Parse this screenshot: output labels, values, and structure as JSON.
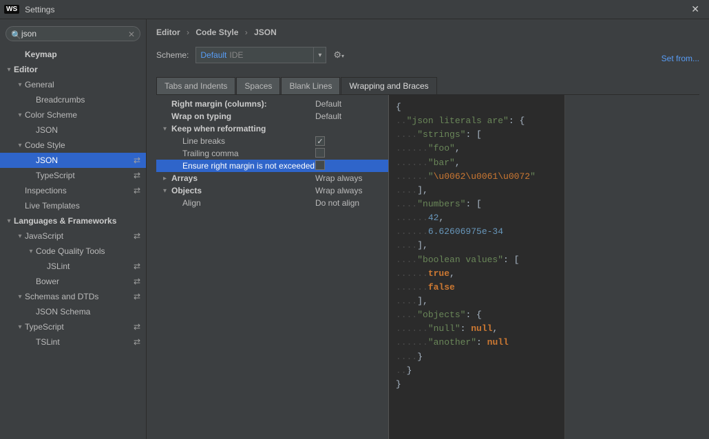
{
  "window": {
    "title": "Settings",
    "badge": "WS"
  },
  "search": {
    "value": "json"
  },
  "tree": [
    {
      "label": "Keymap",
      "indent": 1,
      "arrow": "",
      "bold": true
    },
    {
      "label": "Editor",
      "indent": 0,
      "arrow": "▾",
      "bold": true
    },
    {
      "label": "General",
      "indent": 1,
      "arrow": "▾",
      "bold": false
    },
    {
      "label": "Breadcrumbs",
      "indent": 2,
      "arrow": "",
      "bold": false
    },
    {
      "label": "Color Scheme",
      "indent": 1,
      "arrow": "▾",
      "bold": false
    },
    {
      "label": "JSON",
      "indent": 2,
      "arrow": "",
      "bold": false
    },
    {
      "label": "Code Style",
      "indent": 1,
      "arrow": "▾",
      "bold": false
    },
    {
      "label": "JSON",
      "indent": 2,
      "arrow": "",
      "bold": false,
      "selected": true,
      "icon": "⇄"
    },
    {
      "label": "TypeScript",
      "indent": 2,
      "arrow": "",
      "bold": false,
      "icon": "⇄"
    },
    {
      "label": "Inspections",
      "indent": 1,
      "arrow": "",
      "bold": false,
      "icon": "⇄"
    },
    {
      "label": "Live Templates",
      "indent": 1,
      "arrow": "",
      "bold": false
    },
    {
      "label": "Languages & Frameworks",
      "indent": 0,
      "arrow": "▾",
      "bold": true
    },
    {
      "label": "JavaScript",
      "indent": 1,
      "arrow": "▾",
      "bold": false,
      "icon": "⇄"
    },
    {
      "label": "Code Quality Tools",
      "indent": 2,
      "arrow": "▾",
      "bold": false
    },
    {
      "label": "JSLint",
      "indent": 3,
      "arrow": "",
      "bold": false,
      "icon": "⇄"
    },
    {
      "label": "Bower",
      "indent": 2,
      "arrow": "",
      "bold": false,
      "icon": "⇄"
    },
    {
      "label": "Schemas and DTDs",
      "indent": 1,
      "arrow": "▾",
      "bold": false,
      "icon": "⇄"
    },
    {
      "label": "JSON Schema",
      "indent": 2,
      "arrow": "",
      "bold": false
    },
    {
      "label": "TypeScript",
      "indent": 1,
      "arrow": "▾",
      "bold": false,
      "icon": "⇄"
    },
    {
      "label": "TSLint",
      "indent": 2,
      "arrow": "",
      "bold": false,
      "icon": "⇄"
    }
  ],
  "breadcrumb": [
    "Editor",
    "Code Style",
    "JSON"
  ],
  "scheme": {
    "label": "Scheme:",
    "name": "Default",
    "suffix": "IDE",
    "setfrom": "Set from..."
  },
  "tabs": [
    "Tabs and Indents",
    "Spaces",
    "Blank Lines",
    "Wrapping and Braces"
  ],
  "active_tab": 3,
  "options": [
    {
      "label": "Right margin (columns):",
      "value": "Default",
      "indent": 0,
      "bold": true,
      "arrow": ""
    },
    {
      "label": "Wrap on typing",
      "value": "Default",
      "indent": 0,
      "bold": true,
      "arrow": ""
    },
    {
      "label": "Keep when reformatting",
      "value": "",
      "indent": 0,
      "bold": true,
      "arrow": "▾"
    },
    {
      "label": "Line breaks",
      "value": "",
      "indent": 1,
      "bold": false,
      "arrow": "",
      "checkbox": true,
      "checked": true
    },
    {
      "label": "Trailing comma",
      "value": "",
      "indent": 1,
      "bold": false,
      "arrow": "",
      "checkbox": true,
      "checked": false
    },
    {
      "label": "Ensure right margin is not exceeded",
      "value": "",
      "indent": 1,
      "bold": false,
      "arrow": "",
      "checkbox": true,
      "checked": false,
      "selected": true
    },
    {
      "label": "Arrays",
      "value": "Wrap always",
      "indent": 0,
      "bold": true,
      "arrow": "▸"
    },
    {
      "label": "Objects",
      "value": "Wrap always",
      "indent": 0,
      "bold": true,
      "arrow": "▾"
    },
    {
      "label": "Align",
      "value": "Do not align",
      "indent": 1,
      "bold": false,
      "arrow": ""
    }
  ],
  "code": {
    "lines": [
      [
        {
          "t": "brace",
          "v": "{"
        }
      ],
      [
        {
          "t": "ws",
          "v": ".."
        },
        {
          "t": "str",
          "v": "\"json literals are\""
        },
        {
          "t": "brace",
          "v": ": {"
        }
      ],
      [
        {
          "t": "ws",
          "v": "...."
        },
        {
          "t": "str",
          "v": "\"strings\""
        },
        {
          "t": "brace",
          "v": ": ["
        }
      ],
      [
        {
          "t": "ws",
          "v": "......"
        },
        {
          "t": "str",
          "v": "\"foo\""
        },
        {
          "t": "brace",
          "v": ","
        }
      ],
      [
        {
          "t": "ws",
          "v": "......"
        },
        {
          "t": "str",
          "v": "\"bar\""
        },
        {
          "t": "brace",
          "v": ","
        }
      ],
      [
        {
          "t": "ws",
          "v": "......"
        },
        {
          "t": "str",
          "v": "\""
        },
        {
          "t": "esc",
          "v": "\\u0062\\u0061\\u0072"
        },
        {
          "t": "str",
          "v": "\""
        }
      ],
      [
        {
          "t": "ws",
          "v": "...."
        },
        {
          "t": "brace",
          "v": "],"
        }
      ],
      [
        {
          "t": "ws",
          "v": "...."
        },
        {
          "t": "str",
          "v": "\"numbers\""
        },
        {
          "t": "brace",
          "v": ": ["
        }
      ],
      [
        {
          "t": "ws",
          "v": "......"
        },
        {
          "t": "num",
          "v": "42"
        },
        {
          "t": "brace",
          "v": ","
        }
      ],
      [
        {
          "t": "ws",
          "v": "......"
        },
        {
          "t": "num",
          "v": "6.62606975e-34"
        }
      ],
      [
        {
          "t": "ws",
          "v": "...."
        },
        {
          "t": "brace",
          "v": "],"
        }
      ],
      [
        {
          "t": "ws",
          "v": "...."
        },
        {
          "t": "str",
          "v": "\"boolean values\""
        },
        {
          "t": "brace",
          "v": ": ["
        }
      ],
      [
        {
          "t": "ws",
          "v": "......"
        },
        {
          "t": "bool",
          "v": "true"
        },
        {
          "t": "brace",
          "v": ","
        }
      ],
      [
        {
          "t": "ws",
          "v": "......"
        },
        {
          "t": "bool",
          "v": "false"
        }
      ],
      [
        {
          "t": "ws",
          "v": "...."
        },
        {
          "t": "brace",
          "v": "],"
        }
      ],
      [
        {
          "t": "ws",
          "v": "...."
        },
        {
          "t": "str",
          "v": "\"objects\""
        },
        {
          "t": "brace",
          "v": ": {"
        }
      ],
      [
        {
          "t": "ws",
          "v": "......"
        },
        {
          "t": "str",
          "v": "\"null\""
        },
        {
          "t": "brace",
          "v": ": "
        },
        {
          "t": "null",
          "v": "null"
        },
        {
          "t": "brace",
          "v": ","
        }
      ],
      [
        {
          "t": "ws",
          "v": "......"
        },
        {
          "t": "str",
          "v": "\"another\""
        },
        {
          "t": "brace",
          "v": ": "
        },
        {
          "t": "null",
          "v": "null"
        }
      ],
      [
        {
          "t": "ws",
          "v": "...."
        },
        {
          "t": "brace",
          "v": "}"
        }
      ],
      [
        {
          "t": "ws",
          "v": ".."
        },
        {
          "t": "brace",
          "v": "}"
        }
      ],
      [
        {
          "t": "brace",
          "v": "}"
        }
      ]
    ]
  }
}
